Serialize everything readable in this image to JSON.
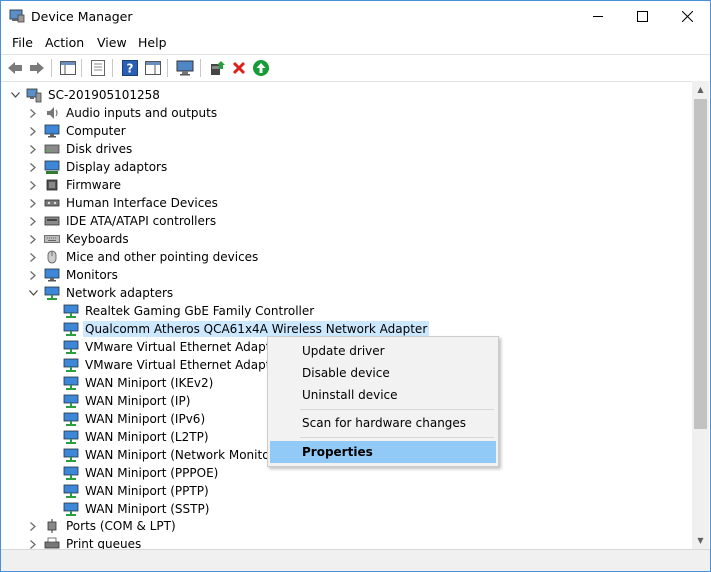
{
  "window": {
    "title": "Device Manager",
    "minimize": "—",
    "maximize": "☐",
    "close": "✕"
  },
  "menu": [
    "File",
    "Action",
    "View",
    "Help"
  ],
  "toolbar": {
    "icons": [
      "back-icon",
      "forward-icon",
      "show-hide-console-tree-icon",
      "properties-icon",
      "help-icon",
      "action-pane-icon",
      "monitor-icon",
      "update-driver-icon",
      "uninstall-icon",
      "enable-device-icon"
    ]
  },
  "tree": {
    "root": "SC-201905101258",
    "categories": [
      "Audio inputs and outputs",
      "Computer",
      "Disk drives",
      "Display adaptors",
      "Firmware",
      "Human Interface Devices",
      "IDE ATA/ATAPI controllers",
      "Keyboards",
      "Mice and other pointing devices",
      "Monitors",
      "Network adapters"
    ],
    "network_children": [
      "Realtek Gaming GbE Family Controller",
      "Qualcomm Atheros QCA61x4A Wireless Network Adapter",
      "VMware Virtual Ethernet Adapter fo",
      "VMware Virtual Ethernet Adapter fo",
      "WAN Miniport (IKEv2)",
      "WAN Miniport (IP)",
      "WAN Miniport (IPv6)",
      "WAN Miniport (L2TP)",
      "WAN Miniport (Network Monitor)",
      "WAN Miniport (PPPOE)",
      "WAN Miniport (PPTP)",
      "WAN Miniport (SSTP)"
    ],
    "after": [
      "Ports (COM & LPT)",
      "Print queues"
    ],
    "selected_index": 1
  },
  "context_menu": {
    "items": [
      "Update driver",
      "Disable device",
      "Uninstall device",
      "Scan for hardware changes",
      "Properties"
    ],
    "highlighted": "Properties"
  },
  "colors": {
    "selection": "#cce8ff",
    "menu_highlight": "#91c9f7",
    "delete_red": "#d9221c",
    "enable_green": "#169c36"
  }
}
